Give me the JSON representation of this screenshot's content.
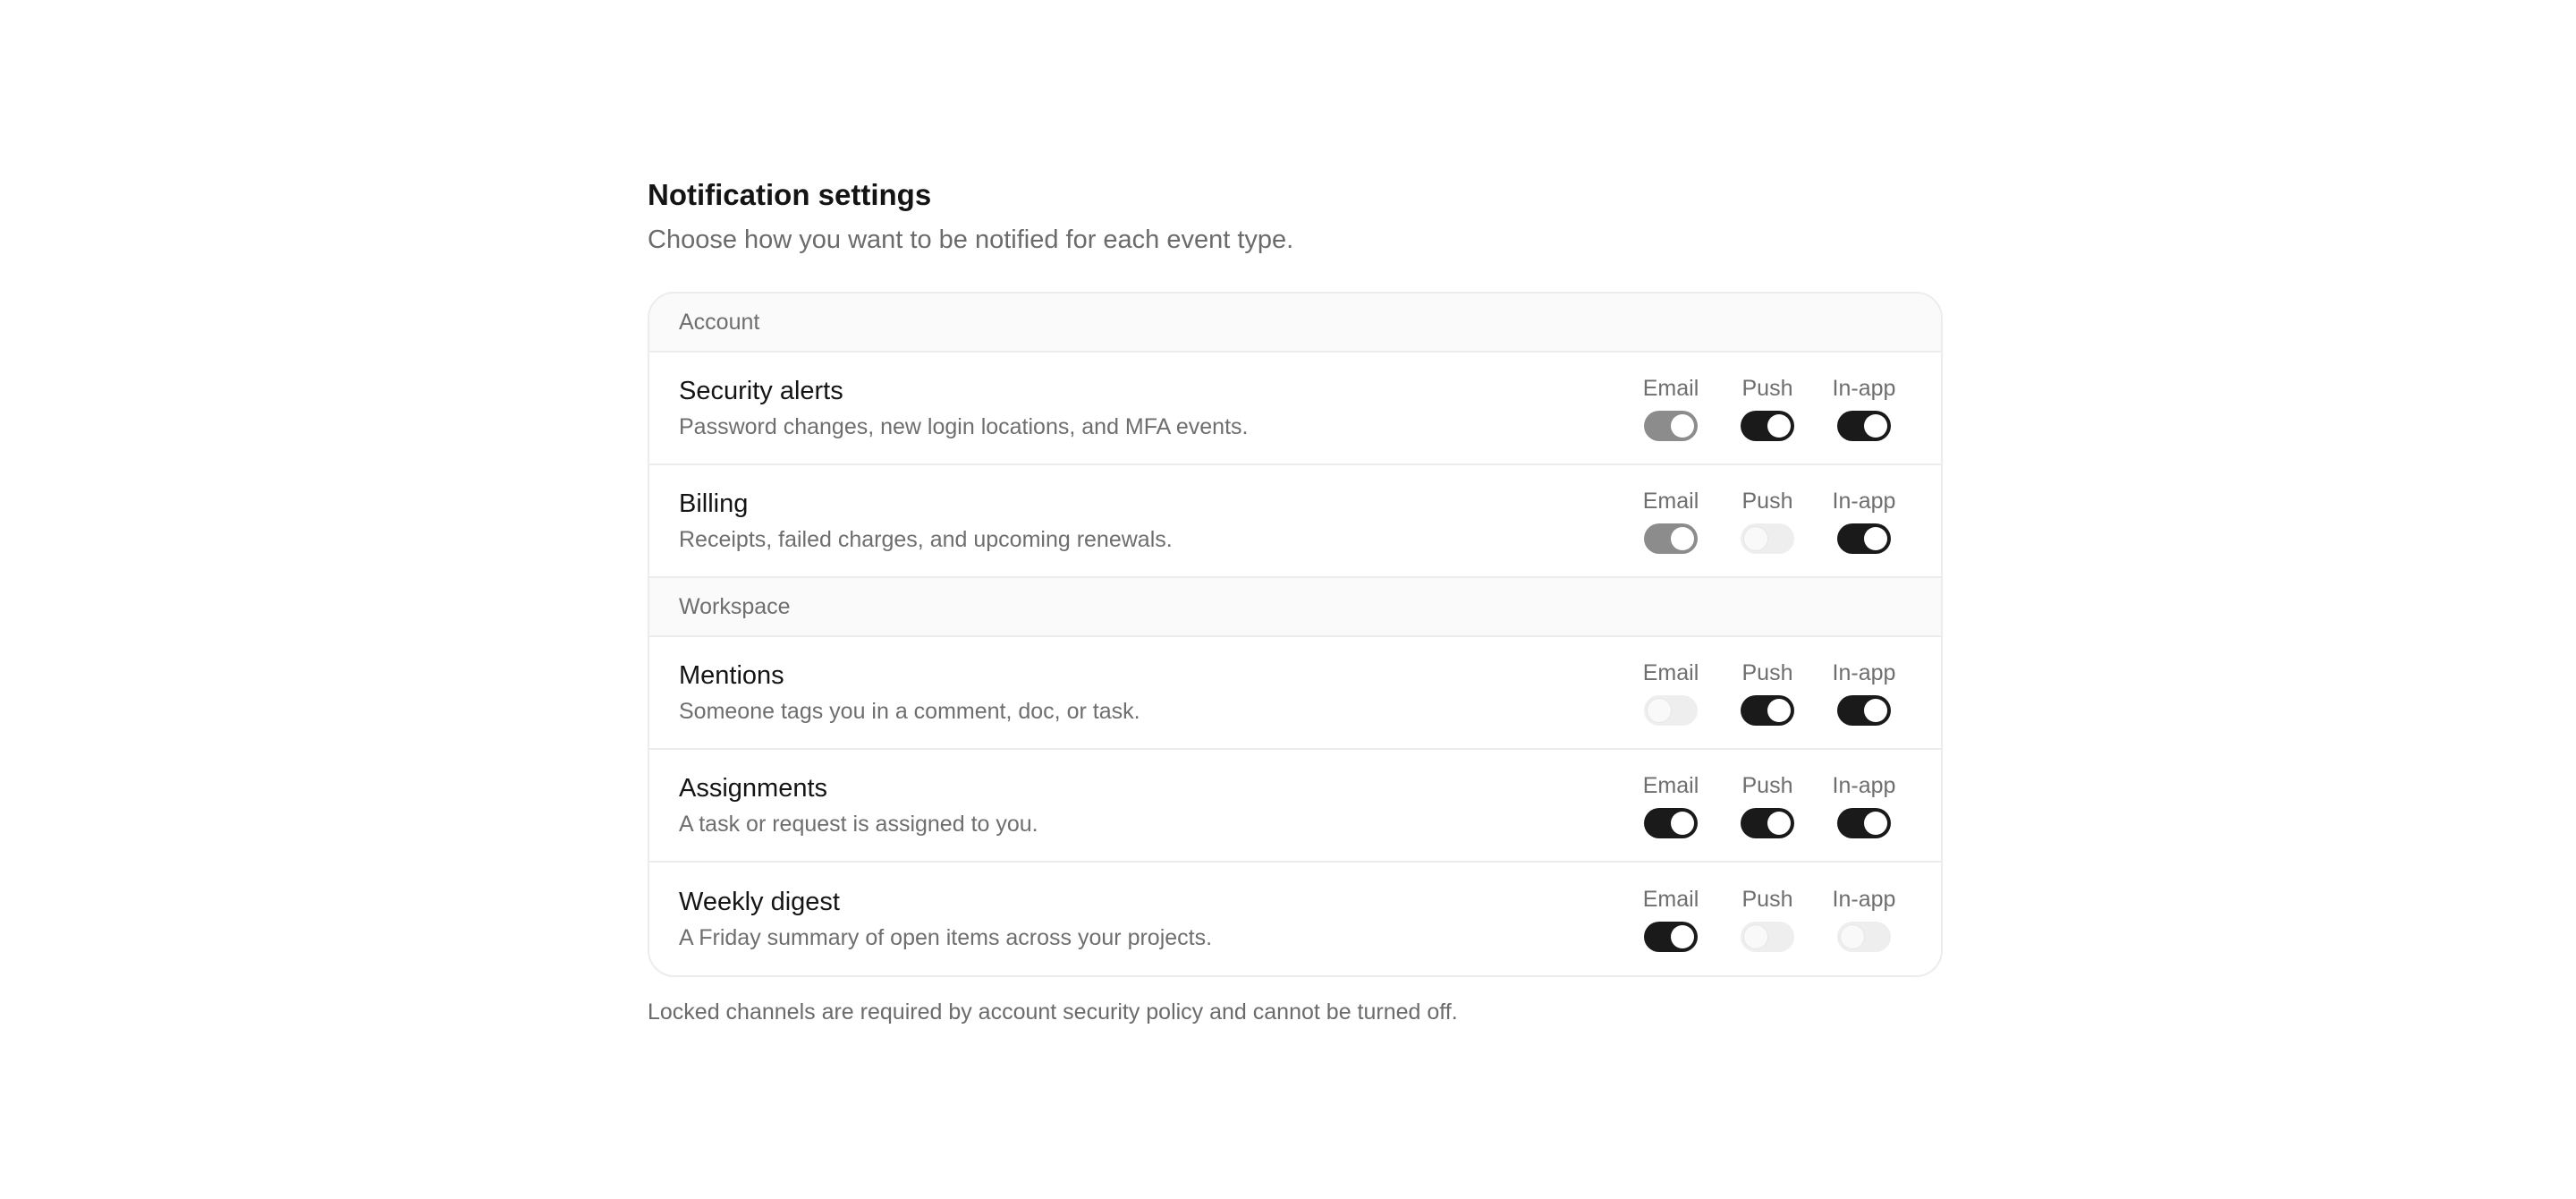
{
  "header": {
    "title": "Notification settings",
    "subtitle": "Choose how you want to be notified for each event type."
  },
  "channels": [
    "Email",
    "Push",
    "In-app"
  ],
  "groups": [
    {
      "label": "Account",
      "items": [
        {
          "title": "Security alerts",
          "description": "Password changes, new login locations, and MFA events.",
          "states": [
            "locked-on",
            "on",
            "on"
          ]
        },
        {
          "title": "Billing",
          "description": "Receipts, failed charges, and upcoming renewals.",
          "states": [
            "locked-on",
            "off",
            "on"
          ]
        }
      ]
    },
    {
      "label": "Workspace",
      "items": [
        {
          "title": "Mentions",
          "description": "Someone tags you in a comment, doc, or task.",
          "states": [
            "off",
            "on",
            "on"
          ]
        },
        {
          "title": "Assignments",
          "description": "A task or request is assigned to you.",
          "states": [
            "on",
            "on",
            "on"
          ]
        },
        {
          "title": "Weekly digest",
          "description": "A Friday summary of open items across your projects.",
          "states": [
            "on",
            "off",
            "off"
          ]
        }
      ]
    }
  ],
  "footnote": "Locked channels are required by account security policy and cannot be turned off.",
  "colors": {
    "toggle_on": "#1a1a1a",
    "toggle_locked": "#8c8c8c",
    "toggle_off": "#eeeeee"
  }
}
